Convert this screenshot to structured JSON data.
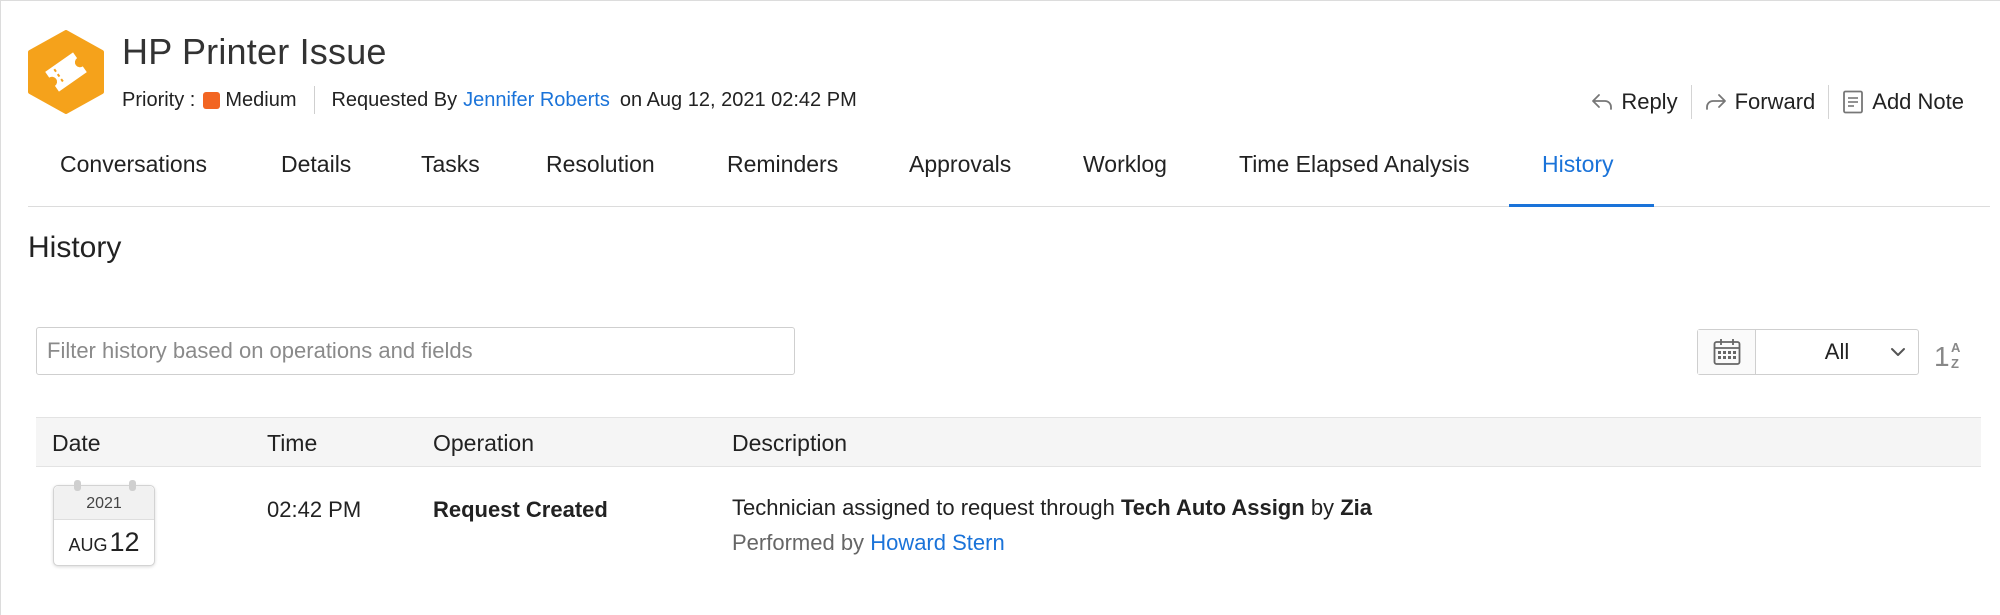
{
  "header": {
    "title": "HP Printer Issue",
    "priority_label": "Priority :",
    "priority_value": "Medium",
    "priority_color": "#f26522",
    "requested_by_label": "Requested By",
    "requester": "Jennifer Roberts",
    "requested_on": "on Aug 12, 2021 02:42 PM",
    "icon": "ticket-icon",
    "icon_color": "#f5a21b"
  },
  "actions": [
    {
      "label": "Reply",
      "icon": "reply-icon"
    },
    {
      "label": "Forward",
      "icon": "forward-icon"
    },
    {
      "label": "Add Note",
      "icon": "note-icon"
    }
  ],
  "tabs": [
    {
      "label": "Conversations"
    },
    {
      "label": "Details"
    },
    {
      "label": "Tasks"
    },
    {
      "label": "Resolution"
    },
    {
      "label": "Reminders"
    },
    {
      "label": "Approvals"
    },
    {
      "label": "Worklog"
    },
    {
      "label": "Time Elapsed Analysis"
    },
    {
      "label": "History",
      "active": true
    }
  ],
  "history": {
    "title": "History",
    "filter_placeholder": "Filter history based on operations and fields",
    "filter_value": "",
    "date_filter_value": "All",
    "columns": [
      "Date",
      "Time",
      "Operation",
      "Description"
    ],
    "rows": [
      {
        "year": "2021",
        "month": "AUG",
        "day": "12",
        "time": "02:42 PM",
        "operation": "Request Created",
        "desc_prefix": "Technician assigned to request through",
        "desc_strong1": "Tech Auto Assign",
        "desc_mid": "by",
        "desc_strong2": "Zia",
        "performed_by_label": "Performed by",
        "performed_by": "Howard Stern"
      }
    ]
  },
  "accent_color": "#1a73d9"
}
